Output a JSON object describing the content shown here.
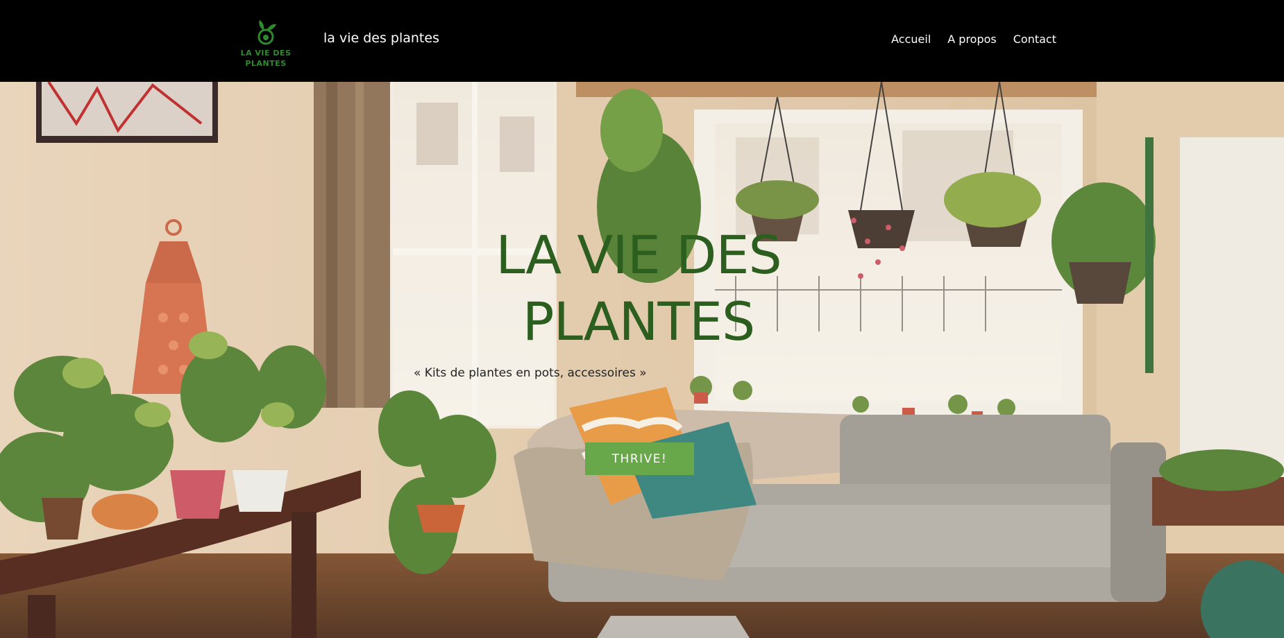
{
  "header": {
    "logo_text": "LA VIE DES PLANTES",
    "site_title": "la vie des plantes",
    "nav": [
      {
        "label": "Accueil"
      },
      {
        "label": "A propos"
      },
      {
        "label": "Contact"
      }
    ]
  },
  "hero": {
    "title": "LA VIE DES PLANTES",
    "tagline": "« Kits de plantes en pots, accessoires »",
    "cta_label": "THRIVE!"
  },
  "colors": {
    "header_bg": "#000000",
    "logo_green": "#2f8a2f",
    "title_green": "#2c5f1f",
    "cta_green": "#69a84a"
  },
  "icons": [
    "sprout-logo-icon"
  ]
}
